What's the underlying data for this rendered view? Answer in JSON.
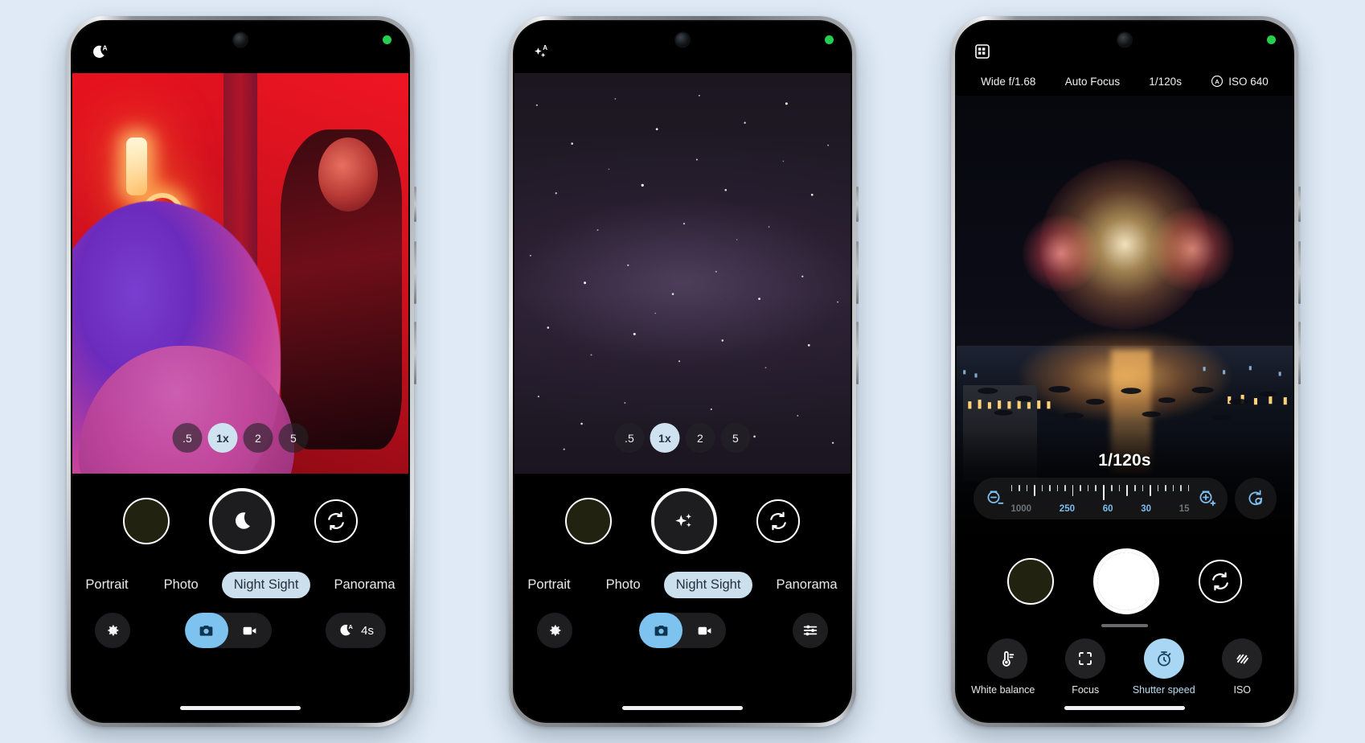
{
  "background_color": "#dfeaf6",
  "accent_blue": "#7ec2ef",
  "mode_active_bg": "#ccdfec",
  "phones": [
    {
      "id": "phone-night-sight-portraits",
      "status": {
        "left_icon": "night-sight-auto-icon",
        "camera_dot": "front-camera-punch-hole",
        "indicator": "green-privacy-dot"
      },
      "zoom_levels": [
        {
          "label": ".5",
          "active": false
        },
        {
          "label": "1x",
          "active": true
        },
        {
          "label": "2",
          "active": false
        },
        {
          "label": "5",
          "active": false
        }
      ],
      "shutter": {
        "thumbnail": "gallery-thumbnail",
        "shutter_icon": "moon-icon",
        "flip_icon": "flip-camera-icon"
      },
      "modes": [
        {
          "label": "Portrait",
          "active": false
        },
        {
          "label": "Photo",
          "active": false
        },
        {
          "label": "Night Sight",
          "active": true
        },
        {
          "label": "Panorama",
          "active": false
        }
      ],
      "toolbar": {
        "settings_icon": "settings-gear-icon",
        "capture_toggle": [
          {
            "icon": "photo-camera-icon",
            "active": true
          },
          {
            "icon": "video-camera-icon",
            "active": false
          }
        ],
        "right_control": {
          "icon": "night-sight-auto-icon",
          "label": "4s"
        }
      }
    },
    {
      "id": "phone-astrophotography",
      "status": {
        "left_icon": "astro-sparkle-auto-icon",
        "camera_dot": "front-camera-punch-hole",
        "indicator": "green-privacy-dot"
      },
      "zoom_levels": [
        {
          "label": ".5",
          "active": false
        },
        {
          "label": "1x",
          "active": true
        },
        {
          "label": "2",
          "active": false
        },
        {
          "label": "5",
          "active": false
        }
      ],
      "shutter": {
        "thumbnail": "gallery-thumbnail",
        "shutter_icon": "sparkle-icon",
        "flip_icon": "flip-camera-icon"
      },
      "modes": [
        {
          "label": "Portrait",
          "active": false
        },
        {
          "label": "Photo",
          "active": false
        },
        {
          "label": "Night Sight",
          "active": true
        },
        {
          "label": "Panorama",
          "active": false
        }
      ],
      "toolbar": {
        "settings_icon": "settings-gear-icon",
        "capture_toggle": [
          {
            "icon": "photo-camera-icon",
            "active": true
          },
          {
            "icon": "video-camera-icon",
            "active": false
          }
        ],
        "right_control": {
          "icon": "tune-sliders-icon",
          "label": ""
        }
      }
    },
    {
      "id": "phone-pro-manual-controls",
      "status": {
        "left_icon": "raw-badge-icon",
        "camera_dot": "front-camera-punch-hole",
        "indicator": "green-privacy-dot"
      },
      "info_bar": [
        {
          "label": "Wide f/1.68",
          "icon": null
        },
        {
          "label": "Auto Focus",
          "icon": null
        },
        {
          "label": "1/120s",
          "icon": null
        },
        {
          "label": "ISO 640",
          "icon": "auto-iso-icon"
        }
      ],
      "shutter_speed_dial": {
        "value": "1/120s",
        "decrease_icon": "shutter-minus-icon",
        "increase_icon": "shutter-plus-icon",
        "reset_icon": "reset-auto-icon",
        "tick_labels": [
          {
            "label": "1000",
            "dim": true
          },
          {
            "label": "250",
            "dim": false
          },
          {
            "label": "60",
            "dim": false
          },
          {
            "label": "30",
            "dim": false
          },
          {
            "label": "15",
            "dim": true
          }
        ]
      },
      "shutter": {
        "thumbnail": "gallery-thumbnail",
        "shutter_icon": "solid-shutter",
        "flip_icon": "flip-camera-icon"
      },
      "pro_tabs": [
        {
          "label": "White balance",
          "icon": "thermometer-icon",
          "active": false
        },
        {
          "label": "Focus",
          "icon": "focus-brackets-icon",
          "active": false
        },
        {
          "label": "Shutter speed",
          "icon": "stopwatch-icon",
          "active": true
        },
        {
          "label": "ISO",
          "icon": "iso-hatch-icon",
          "active": false
        }
      ],
      "drag_handle": "bottom-sheet-drag-handle",
      "gesture_bar": "home-gesture-bar"
    }
  ]
}
